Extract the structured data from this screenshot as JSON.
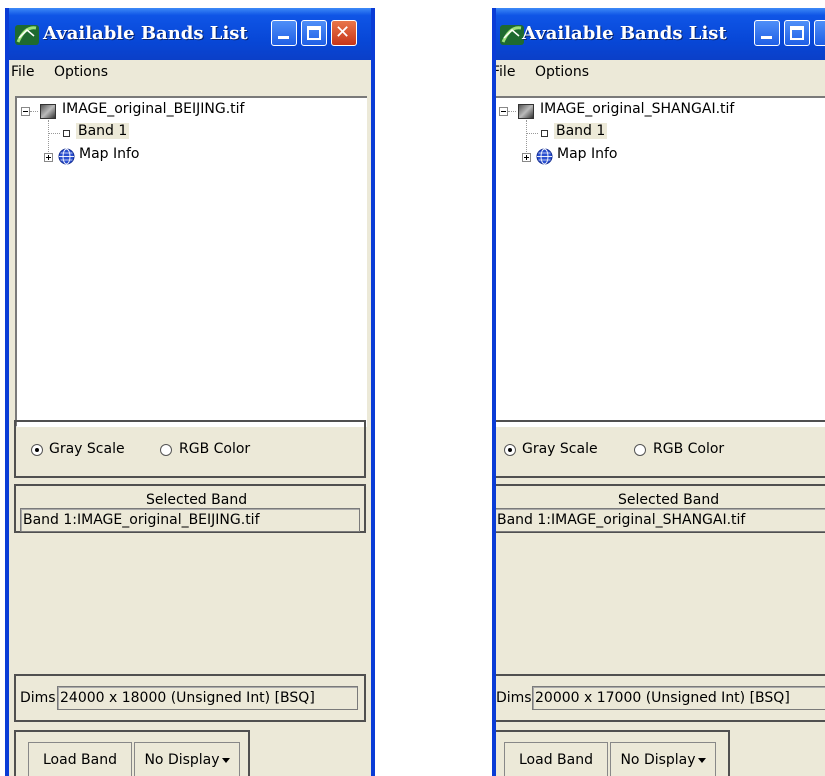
{
  "windows": [
    {
      "title": "Available Bands List",
      "menu": [
        "File",
        "Options"
      ],
      "tree": {
        "file": "IMAGE_original_BEIJING.tif",
        "band": "Band 1",
        "map_info": "Map Info"
      },
      "mode": {
        "gray": "Gray Scale",
        "rgb": "RGB Color",
        "selected": "Gray Scale"
      },
      "selected_band": {
        "heading": "Selected Band",
        "value": "Band 1:IMAGE_original_BEIJING.tif"
      },
      "dims": {
        "label": "Dims",
        "value": "24000 x 18000 (Unsigned Int) [BSQ]"
      },
      "buttons": {
        "load": "Load Band",
        "display": "No Display"
      }
    },
    {
      "title": "Available Bands List",
      "menu": [
        "File",
        "Options"
      ],
      "tree": {
        "file": "IMAGE_original_SHANGAI.tif",
        "band": "Band 1",
        "map_info": "Map Info"
      },
      "mode": {
        "gray": "Gray Scale",
        "rgb": "RGB Color",
        "selected": "Gray Scale"
      },
      "selected_band": {
        "heading": "Selected Band",
        "value": "Band 1:IMAGE_original_SHANGAI.tif"
      },
      "dims": {
        "label": "Dims",
        "value": "20000 x 17000 (Unsigned Int) [BSQ]"
      },
      "buttons": {
        "load": "Load Band",
        "display": "No Display"
      }
    }
  ],
  "colors": {
    "titlebar": "#0a48d8",
    "border": "#0a3cd6",
    "window_bg": "#ece9d8"
  }
}
